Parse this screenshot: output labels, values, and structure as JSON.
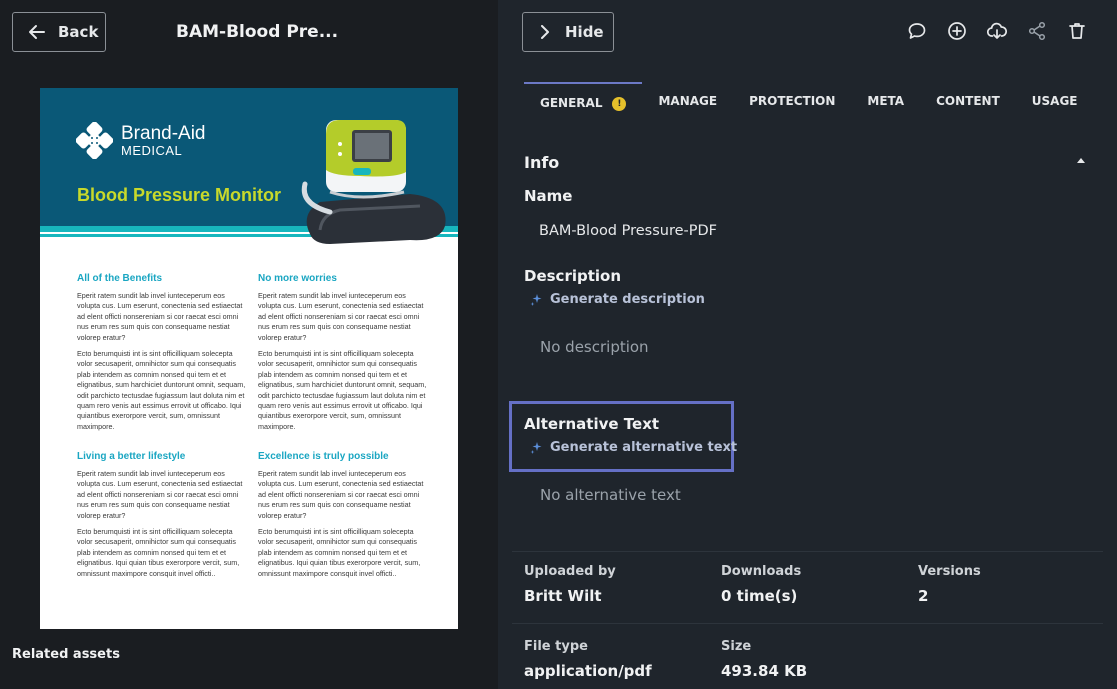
{
  "header": {
    "back_label": "Back",
    "asset_title": "BAM-Blood Pre...",
    "hide_label": "Hide"
  },
  "toolbar": {
    "icons": [
      "comment-icon",
      "add-circle-icon",
      "cloud-download-icon",
      "share-icon",
      "trash-icon"
    ]
  },
  "left": {
    "related_assets_label": "Related assets"
  },
  "document": {
    "brand_name": "Brand-Aid",
    "brand_sub": "MEDICAL",
    "headline": "Blood Pressure Monitor",
    "columns": [
      {
        "heading": "All of the Benefits",
        "p1": "Eperit ratem sundit lab invel iunteceperum eos volupta cus. Lum eserunt, conectenia sed estiaectat ad elent officti nonsereniam si cor raecat esci omni nus erum res sum quis con consequame nestiat volorep eratur?",
        "p2": "Ecto berumquisti int is sint officilliquam solecepta volor secusaperit, omnihictor sum qui consequatis plab intendem as comnim nonsed qui tem et et elignatibus, sum harchiciet duntorunt omnit, sequam, odit parchicto tectusdae fugiassum laut doluta nim et quam rero venis aut essimus errovit ut officabo. Iqui quiantibus exerorpore vercit, sum, omnissunt maximpore."
      },
      {
        "heading": "No more worries",
        "p1": "Eperit ratem sundit lab invel iunteceperum eos volupta cus. Lum eserunt, conectenia sed estiaectat ad elent officti nonsereniam si cor raecat esci omni nus erum res sum quis con consequame nestiat volorep eratur?",
        "p2": "Ecto berumquisti int is sint officilliquam solecepta volor secusaperit, omnihictor sum qui consequatis plab intendem as comnim nonsed qui tem et et elignatibus, sum harchiciet duntorunt omnit, sequam, odit parchicto tectusdae fugiassum laut doluta nim et quam rero venis aut essimus errovit ut officabo. Iqui quiantibus exerorpore vercit, sum, omnissunt maximpore."
      },
      {
        "heading": "Living a better lifestyle",
        "p1": "Eperit ratem sundit lab invel iunteceperum eos volupta cus. Lum eserunt, conectenia sed estiaectat ad elent officti nonsereniam si cor raecat esci omni nus erum res sum quis con consequame nestiat volorep eratur?",
        "p2": "Ecto berumquisti int is sint officilliquam solecepta volor secusaperit, omnihictor sum qui consequatis plab intendem as comnim nonsed qui tem et et elignatibus. Iqui quian tibus exerorpore vercit, sum, omnissunt maximpore consquit invel officti.."
      },
      {
        "heading": "Excellence is truly possible",
        "p1": "Eperit ratem sundit lab invel iunteceperum eos volupta cus. Lum eserunt, conectenia sed estiaectat ad elent officti nonsereniam si cor raecat esci omni nus erum res sum quis con consequame nestiat volorep eratur?",
        "p2": "Ecto berumquisti int is sint officilliquam solecepta volor secusaperit, omnihictor sum qui consequatis plab intendem as comnim nonsed qui tem et et elignatibus. Iqui quian tibus exerorpore vercit, sum, omnissunt maximpore consquit invel officti.."
      }
    ]
  },
  "tabs": [
    {
      "label": "GENERAL",
      "badge": "!"
    },
    {
      "label": "MANAGE"
    },
    {
      "label": "PROTECTION"
    },
    {
      "label": "META"
    },
    {
      "label": "CONTENT"
    },
    {
      "label": "USAGE"
    }
  ],
  "info": {
    "section_title": "Info",
    "name_label": "Name",
    "name_value": "BAM-Blood Pressure-PDF",
    "description_label": "Description",
    "generate_description": "Generate description",
    "description_empty": "No description",
    "alt_label": "Alternative Text",
    "generate_alt": "Generate alternative text",
    "alt_empty": "No alternative text"
  },
  "meta": {
    "uploaded_by_label": "Uploaded by",
    "uploaded_by_value": "Britt Wilt",
    "downloads_label": "Downloads",
    "downloads_value": "0 time(s)",
    "versions_label": "Versions",
    "versions_value": "2",
    "file_type_label": "File type",
    "file_type_value": "application/pdf",
    "size_label": "Size",
    "size_value": "493.84 KB"
  },
  "colors": {
    "accent": "#6c79c6",
    "highlight_box": "#6570c6",
    "badge": "#e5c02b",
    "doc_header": "#0a5877",
    "doc_teal": "#17b6bd",
    "doc_lime": "#c8d92b"
  }
}
